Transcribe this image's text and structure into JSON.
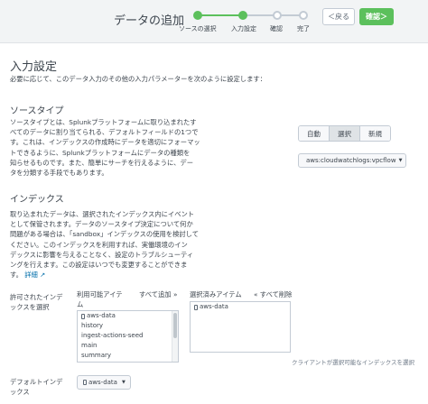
{
  "header": {
    "title": "データの追加",
    "steps": [
      {
        "label": "ソースの選択",
        "state": "done"
      },
      {
        "label": "入力設定",
        "state": "done"
      },
      {
        "label": "確認",
        "state": "todo"
      },
      {
        "label": "完了",
        "state": "todo"
      }
    ],
    "back_label": "＜戻る",
    "next_label": "確認＞"
  },
  "page": {
    "title": "入力設定",
    "intro": "必要に応じて、このデータ入力のその他の入力パラメーターを次のように設定します："
  },
  "sourcetype": {
    "heading": "ソースタイプ",
    "description": [
      "ソースタイプとは、Splunkプラットフォームに取り込まれたす",
      "べてのデータに割り当てられる、デフォルトフィールドの1つで",
      "す。これは、インデックスの作成時にデータを適切にフォーマッ",
      "トできるように、Splunkプラットフォームにデータの種類を",
      "知らせるものです。また、簡単にサーチを行えるように、デー",
      "タを分類する手段でもあります。"
    ],
    "modes": [
      "自動",
      "選択",
      "新規"
    ],
    "active_mode": "選択",
    "selected": "aws:cloudwatchlogs:vpcflow"
  },
  "index": {
    "heading": "インデックス",
    "description": [
      "取り込まれたデータは、選択されたインデックス内にイベント",
      "として保管されます。データのソースタイプ決定について何か",
      "問題がある場合は、「sandbox」インデックスの使用を検討して",
      "ください。このインデックスを利用すれば、実働環境のイン",
      "デックスに影響を与えることなく、設定のトラブルシューティ",
      "ングを行えます。この設定はいつでも変更することができま",
      "す。"
    ],
    "details_link": "詳細",
    "allowed_label": [
      "許可されたインデ",
      "ックスを選択"
    ],
    "available_header": [
      "利用可能アイテ",
      "ム"
    ],
    "add_all": "すべて追加 »",
    "selected_header": "選択済みアイテム",
    "remove_all": "« すべて削除",
    "available_items": [
      "aws-data",
      "history",
      "ingest-actions-seed",
      "main",
      "summary"
    ],
    "selected_items": [
      "aws-data"
    ],
    "help_text": "クライアントが選択可能なインデックスを選択",
    "default_label": [
      "デフォルトインデ",
      "ックス"
    ],
    "default_value": "aws-data"
  }
}
